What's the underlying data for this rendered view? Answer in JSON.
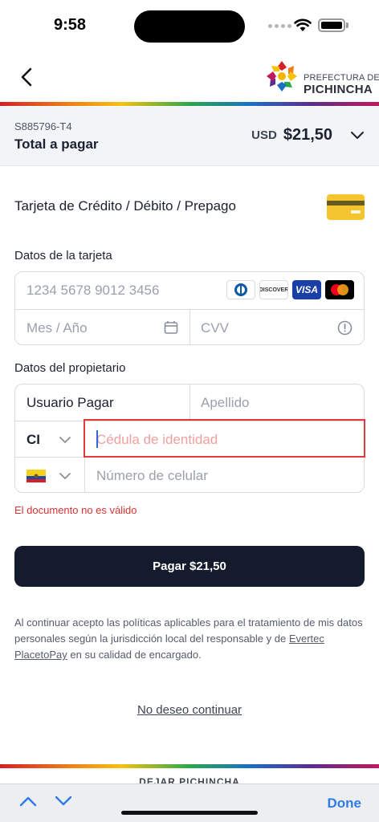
{
  "status_bar": {
    "time": "9:58"
  },
  "header": {
    "logo_top": "PREFECTURA DE",
    "logo_bottom": "PICHINCHA"
  },
  "summary": {
    "reference": "S885796-T4",
    "total_label": "Total a pagar",
    "currency": "USD",
    "amount": "$21,50"
  },
  "payment_method": {
    "title": "Tarjeta de Crédito / Débito / Prepago"
  },
  "card_section": {
    "label": "Datos de la tarjeta",
    "card_number_placeholder": "1234 5678 9012 3456",
    "expiry_placeholder": "Mes / Año",
    "cvv_placeholder": "CVV",
    "brands": [
      "diners-club",
      "discover",
      "visa",
      "mastercard"
    ],
    "discover_text": "DISCOVER",
    "visa_text": "VISA"
  },
  "owner_section": {
    "label": "Datos del propietario",
    "first_name_value": "Usuario Pagar",
    "last_name_placeholder": "Apellido",
    "document_type": "CI",
    "document_placeholder": "Cédula de identidad",
    "phone_placeholder": "Número de celular",
    "country_flag": "ecuador"
  },
  "error_message": "El documento no es válido",
  "pay_button": "Pagar $21,50",
  "terms": {
    "text_1": "Al continuar acepto las políticas aplicables para el tratamiento de mis datos personales según la jurisdicción local del responsable y de ",
    "link": "Evertec PlacetoPay",
    "text_2": " en su calidad de encargado."
  },
  "no_continue": "No deseo continuar",
  "footer_peek": "DEJAR PICHINCHA",
  "keyboard_bar": {
    "done": "Done"
  },
  "colors": {
    "primary": "#141b2d",
    "error": "#d93232",
    "link_blue": "#2f7be8",
    "card_yellow": "#f4c530"
  }
}
